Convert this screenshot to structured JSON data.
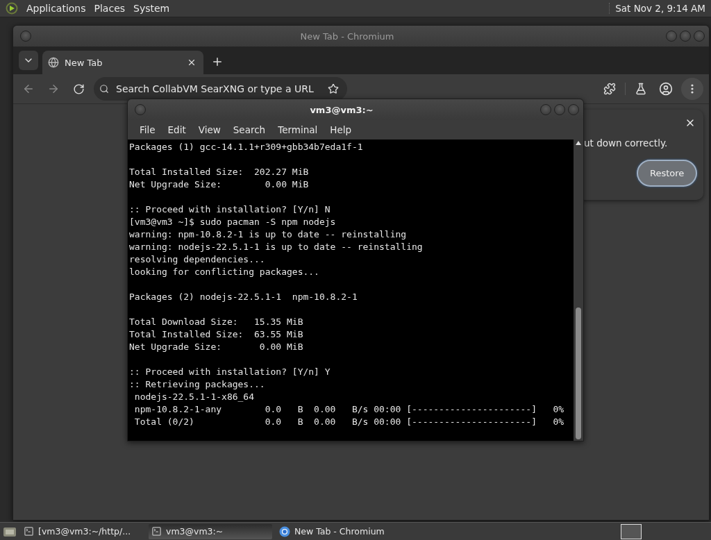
{
  "top_panel": {
    "menus": [
      "Applications",
      "Places",
      "System"
    ],
    "clock": "Sat Nov 2, 9:14 AM"
  },
  "browser": {
    "title": "New Tab - Chromium",
    "tabs": [
      {
        "label": "New Tab",
        "selected": true
      }
    ],
    "address_bar": {
      "placeholder": "Search CollabVM SearXNG or type a URL"
    },
    "restore_popup": {
      "message": "ut down correctly.",
      "button": "Restore"
    }
  },
  "terminal": {
    "title": "vm3@vm3:~",
    "menu": [
      "File",
      "Edit",
      "View",
      "Search",
      "Terminal",
      "Help"
    ],
    "paragraphs": [
      [
        "Packages (1) gcc-14.1.1+r309+gbb34b7eda1f-1"
      ],
      [
        "Total Installed Size:  202.27 MiB",
        "Net Upgrade Size:        0.00 MiB"
      ],
      [
        ":: Proceed with installation? [Y/n] N",
        "[vm3@vm3 ~]$ sudo pacman -S npm nodejs",
        "warning: npm-10.8.2-1 is up to date -- reinstalling",
        "warning: nodejs-22.5.1-1 is up to date -- reinstalling",
        "resolving dependencies...",
        "looking for conflicting packages..."
      ],
      [
        "Packages (2) nodejs-22.5.1-1  npm-10.8.2-1"
      ],
      [
        "Total Download Size:   15.35 MiB",
        "Total Installed Size:  63.55 MiB",
        "Net Upgrade Size:       0.00 MiB"
      ],
      [
        ":: Proceed with installation? [Y/n] Y",
        ":: Retrieving packages...",
        " nodejs-22.5.1-1-x86_64",
        " npm-10.8.2-1-any        0.0   B  0.00   B/s 00:00 [----------------------]   0%",
        " Total (0/2)             0.0   B  0.00   B/s 00:00 [----------------------]   0%"
      ]
    ]
  },
  "taskbar": {
    "items": [
      {
        "label": "[vm3@vm3:~/http/...",
        "kind": "terminal",
        "selected": false
      },
      {
        "label": "vm3@vm3:~",
        "kind": "terminal",
        "selected": true
      },
      {
        "label": "New Tab - Chromium",
        "kind": "browser",
        "selected": false
      }
    ]
  }
}
